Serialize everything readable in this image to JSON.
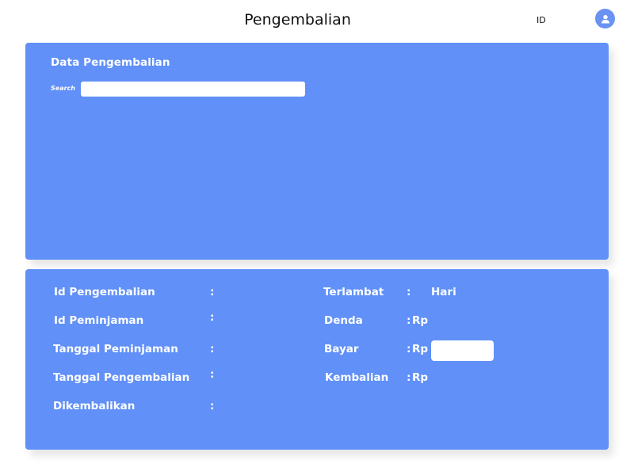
{
  "header": {
    "title": "Pengembalian",
    "user_id_label": "ID",
    "avatar_icon": "user-icon"
  },
  "colors": {
    "panel": "#6090f8",
    "avatar": "#6a92f2",
    "text_on_panel": "#ffffff"
  },
  "data_panel": {
    "title": "Data Pengembalian",
    "search_label": "Search",
    "search_value": "",
    "search_placeholder": ""
  },
  "detail_form": {
    "left_fields": [
      {
        "label": "Id Pengembalian",
        "colon": ":"
      },
      {
        "label": "Id Peminjaman",
        "colon": ":"
      },
      {
        "label": "Tanggal Peminjaman",
        "colon": ":"
      },
      {
        "label": "Tanggal Pengembalian",
        "colon": ":"
      },
      {
        "label": "Dikembalikan",
        "colon": ":"
      }
    ],
    "right_fields": [
      {
        "label": "Terlambat",
        "colon": ":",
        "unit": "Hari"
      },
      {
        "label": "Denda",
        "colon": ":",
        "unit": "Rp"
      },
      {
        "label": "Bayar",
        "colon": ":",
        "unit": "Rp",
        "input_value": ""
      },
      {
        "label": "Kembalian",
        "colon": ":",
        "unit": "Rp"
      }
    ]
  }
}
